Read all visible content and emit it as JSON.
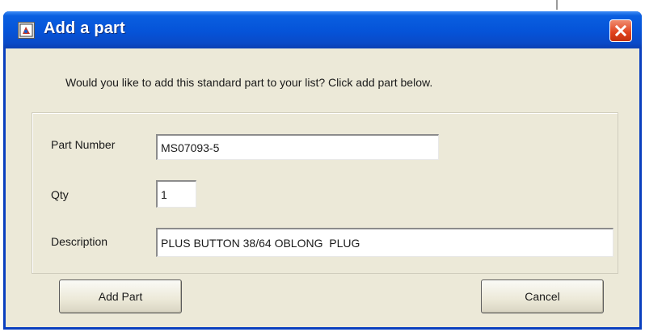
{
  "window": {
    "title": "Add a part",
    "titlebar_color": "#0553d8",
    "icons": [
      "app-icon",
      "close-icon"
    ]
  },
  "message": "Would you like to add this standard part to your list?  Click add part below.",
  "form": {
    "part_number": {
      "label": "Part Number",
      "value": "MS07093-5"
    },
    "qty": {
      "label": "Qty",
      "value": "1"
    },
    "description": {
      "label": "Description",
      "value": "PLUS BUTTON 38/64 OBLONG  PLUG"
    }
  },
  "buttons": {
    "add_part": "Add Part",
    "cancel": "Cancel"
  }
}
